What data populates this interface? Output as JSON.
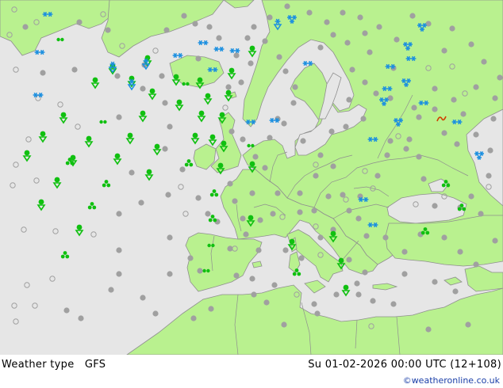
{
  "footer": {
    "title": "Weather type",
    "model": "GFS",
    "valid_time": "Su 01-02-2026 00:00 UTC (12+108)",
    "credit": "©weatheronline.co.uk"
  },
  "colors": {
    "sea": "#e6e6e6",
    "land": "#b9f18f",
    "border": "#8f8f8f",
    "rain": "#10c010",
    "snow": "#1a8fe0",
    "cloud": "#a0a0a0",
    "freezing": "#d04000"
  },
  "legend_symbols": [
    "rain-shower-icon",
    "rain-icon",
    "drizzle-icon",
    "snow-icon",
    "snow-shower-icon",
    "overcast-icon",
    "cloudy-icon",
    "freezing-rain-icon"
  ]
}
